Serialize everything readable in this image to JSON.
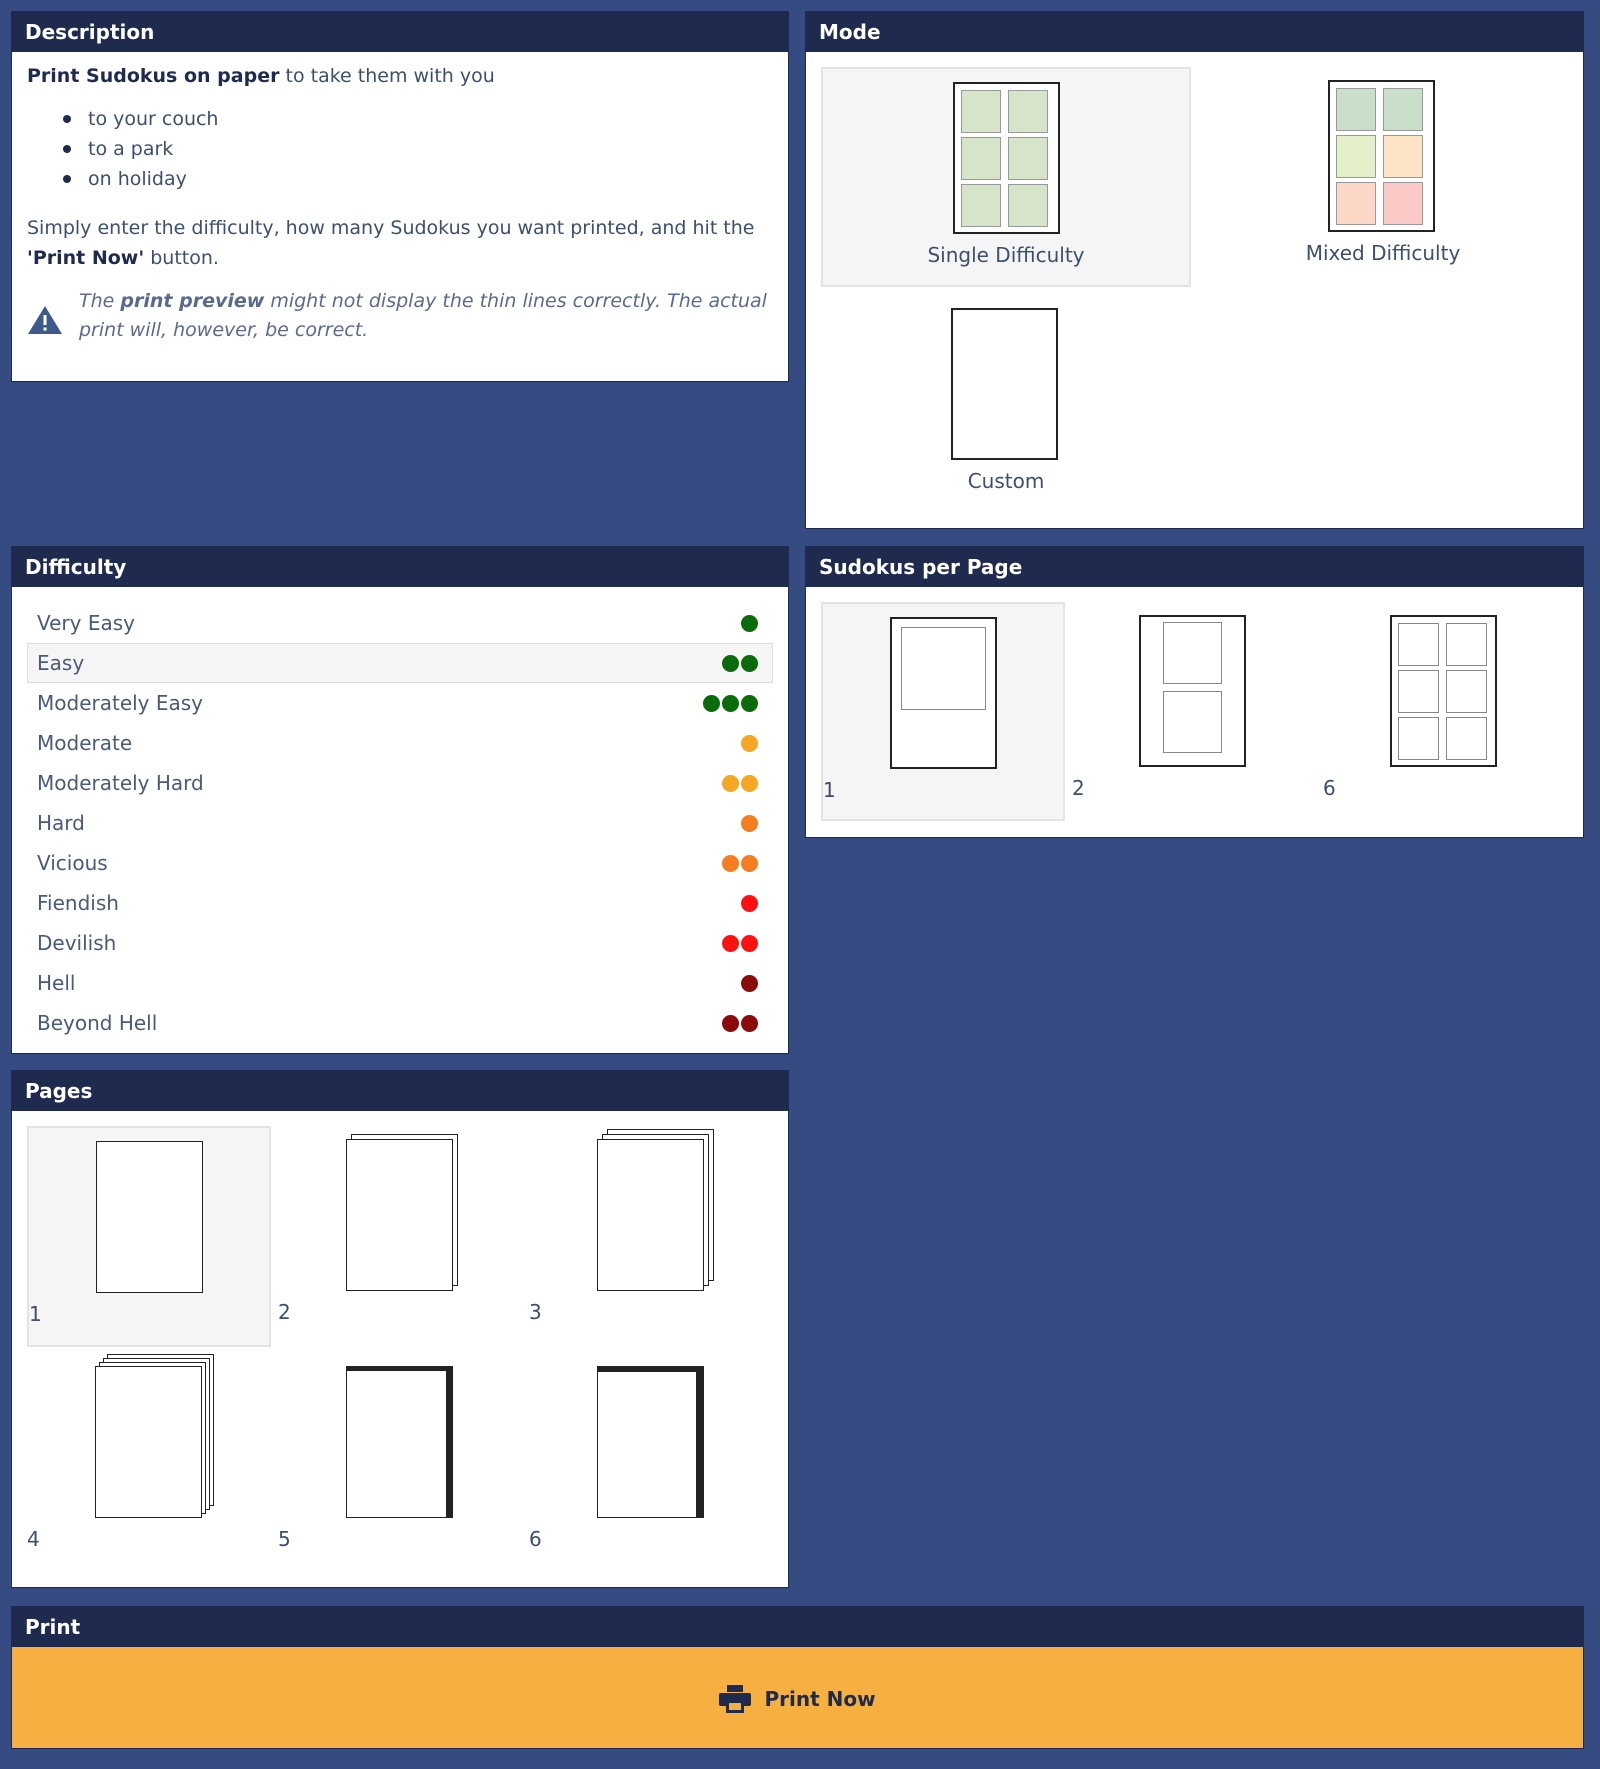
{
  "description": {
    "header": "Description",
    "lead_bold": "Print Sudokus on paper",
    "lead_rest": " to take them with you",
    "bullets": [
      "to your couch",
      "to a park",
      "on holiday"
    ],
    "instr_pre": "Simply enter the difficulty, how many Sudokus you want printed, and hit the ",
    "instr_bold": "'Print Now'",
    "instr_post": " button.",
    "warn_pre": "The ",
    "warn_bold": "print preview",
    "warn_post": " might not display the thin lines correctly. The actual print will, however, be correct."
  },
  "mode": {
    "header": "Mode",
    "options": [
      "Single Difficulty",
      "Mixed Difficulty",
      "Custom"
    ],
    "single_color": "#d6e4c9",
    "mixed_colors": [
      "#c9dfc9",
      "#c9dfc9",
      "#e4eec9",
      "#fce3c5",
      "#fcd7c7",
      "#fccac6"
    ]
  },
  "difficulty": {
    "header": "Difficulty",
    "items": [
      {
        "label": "Very Easy",
        "dots": [
          "#0a6b0a"
        ]
      },
      {
        "label": "Easy",
        "dots": [
          "#0a6b0a",
          "#0a6b0a"
        ]
      },
      {
        "label": "Moderately Easy",
        "dots": [
          "#0a6b0a",
          "#0a6b0a",
          "#0a6b0a"
        ]
      },
      {
        "label": "Moderate",
        "dots": [
          "#f5a623"
        ]
      },
      {
        "label": "Moderately Hard",
        "dots": [
          "#f5a623",
          "#f5a623"
        ]
      },
      {
        "label": "Hard",
        "dots": [
          "#f57c1f"
        ]
      },
      {
        "label": "Vicious",
        "dots": [
          "#f57c1f",
          "#f57c1f"
        ]
      },
      {
        "label": "Fiendish",
        "dots": [
          "#ff1111"
        ]
      },
      {
        "label": "Devilish",
        "dots": [
          "#ff1111",
          "#ff1111"
        ]
      },
      {
        "label": "Hell",
        "dots": [
          "#8b0a0a"
        ]
      },
      {
        "label": "Beyond Hell",
        "dots": [
          "#8b0a0a",
          "#8b0a0a"
        ]
      }
    ],
    "selected": "Easy"
  },
  "sudokus_per_page": {
    "header": "Sudokus per Page",
    "options": [
      "1",
      "2",
      "6"
    ]
  },
  "pages": {
    "header": "Pages",
    "options": [
      "1",
      "2",
      "3",
      "4",
      "5",
      "6"
    ]
  },
  "print": {
    "header": "Print",
    "button_label": "Print Now"
  }
}
